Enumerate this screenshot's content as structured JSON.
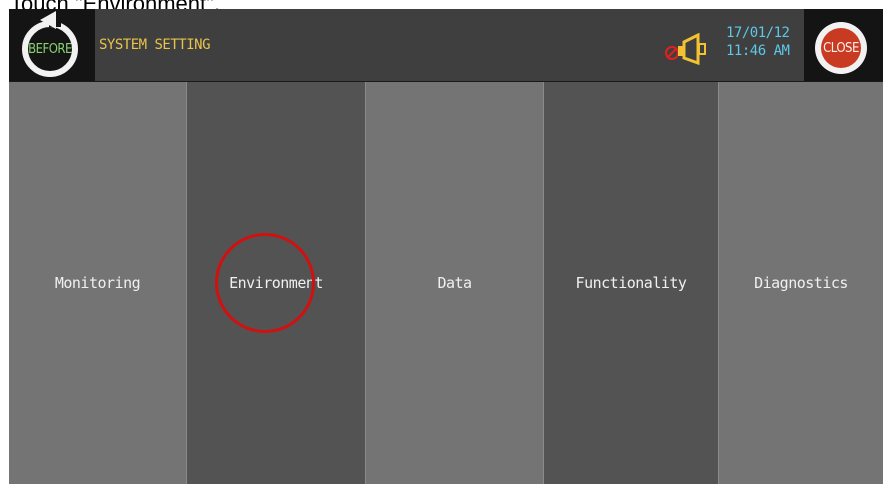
{
  "caption": "Touch \"Environment\".",
  "header": {
    "before_label": "BEFORE",
    "title": "SYSTEM SETTING",
    "date": "17/01/12",
    "time": "11:46 AM",
    "close_label": "CLOSE",
    "icons": {
      "before": "rotate-back-icon",
      "alarm": "buzzer-muted-icon"
    }
  },
  "menu": {
    "items": [
      {
        "label": "Monitoring"
      },
      {
        "label": "Environment"
      },
      {
        "label": "Data"
      },
      {
        "label": "Functionality"
      },
      {
        "label": "Diagnostics"
      }
    ]
  },
  "colors": {
    "title": "#e8c44a",
    "datetime": "#5ec7e8",
    "close": "#c83a22",
    "highlight": "#d21010"
  }
}
